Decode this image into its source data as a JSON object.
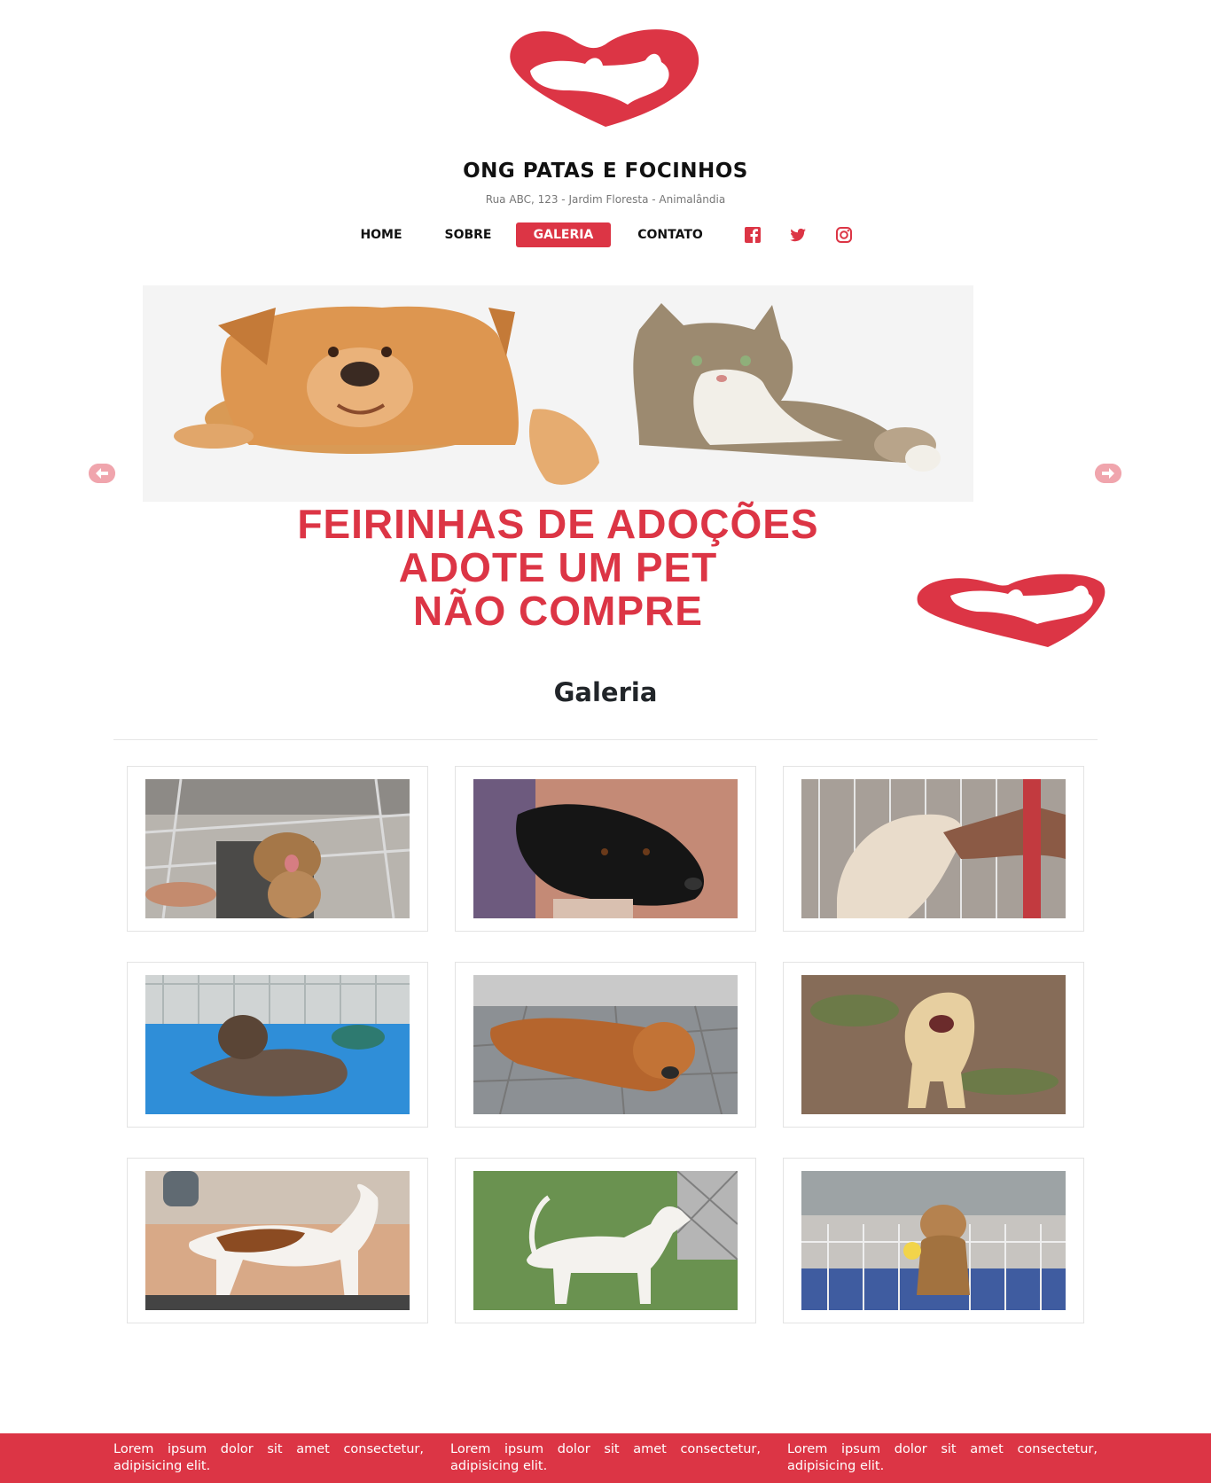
{
  "header": {
    "title": "ONG PATAS E FOCINHOS",
    "address": "Rua ABC, 123 - Jardim Floresta - Animalândia"
  },
  "nav": {
    "items": [
      {
        "label": "HOME",
        "active": false
      },
      {
        "label": "SOBRE",
        "active": false
      },
      {
        "label": "GALERIA",
        "active": true
      },
      {
        "label": "CONTATO",
        "active": false
      }
    ],
    "social": [
      "facebook-icon",
      "twitter-icon",
      "instagram-icon"
    ]
  },
  "carousel": {
    "lines": [
      "FEIRINHAS DE ADOÇÕES",
      "ADOTE UM PET",
      "NÃO COMPRE"
    ]
  },
  "gallery": {
    "title": "Galeria",
    "photos": [
      "dog-in-kennel-photo",
      "black-dog-photo",
      "white-puppy-photo",
      "puppy-on-blue-mat-photo",
      "brown-dog-lying-photo",
      "cream-dog-on-dirt-photo",
      "brown-white-dog-photo",
      "white-dog-on-grass-photo",
      "puppy-in-pen-photo"
    ]
  },
  "footer": {
    "columns": [
      "Lorem ipsum dolor sit amet consectetur, adipisicing elit.",
      "Lorem ipsum dolor sit amet consectetur, adipisicing elit.",
      "Lorem ipsum dolor sit amet consectetur, adipisicing elit."
    ]
  },
  "colors": {
    "brand": "#dc3545",
    "footer": "#dc3545"
  }
}
